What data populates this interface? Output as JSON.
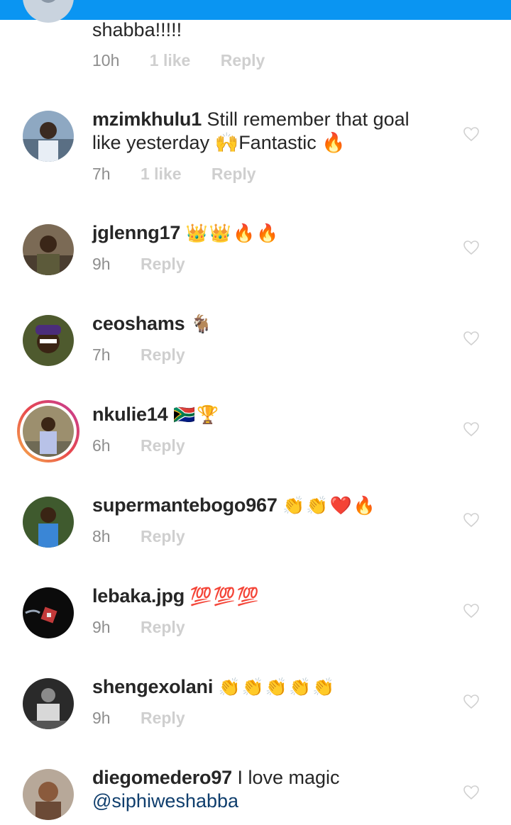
{
  "comments": [
    {
      "text": "shabba!!!!!",
      "time": "10h",
      "likes": "1 like",
      "reply": "Reply"
    },
    {
      "username": "mzimkhulu1",
      "text_line1": "Still remember that goal",
      "text_line2": "like yesterday 🙌Fantastic 🔥",
      "time": "7h",
      "likes": "1 like",
      "reply": "Reply"
    },
    {
      "username": "jglenng17",
      "emoji": "👑👑🔥🔥",
      "time": "9h",
      "reply": "Reply"
    },
    {
      "username": "ceoshams",
      "emoji": "🐐",
      "time": "7h",
      "reply": "Reply"
    },
    {
      "username": "nkulie14",
      "emoji": "🇿🇦🏆",
      "time": "6h",
      "reply": "Reply"
    },
    {
      "username": "supermantebogo967",
      "emoji": "👏👏❤️🔥",
      "time": "8h",
      "reply": "Reply"
    },
    {
      "username": "lebaka.jpg",
      "emoji": "💯💯💯",
      "time": "9h",
      "reply": "Reply"
    },
    {
      "username": "shengexolani",
      "emoji": "👏👏👏👏👏",
      "time": "9h",
      "reply": "Reply"
    },
    {
      "username": "diegomedero97",
      "text_line1": "I love magic",
      "mention": "@siphiweshabba"
    }
  ],
  "colors": {
    "topbar": "#0a95f2",
    "text": "#262626",
    "meta": "#8e8e8e",
    "meta_faint": "#cfcfcf",
    "mention": "#0f3e6d",
    "story_ring": "#e8484d"
  },
  "icons": {
    "like": "heart-outline-icon"
  }
}
